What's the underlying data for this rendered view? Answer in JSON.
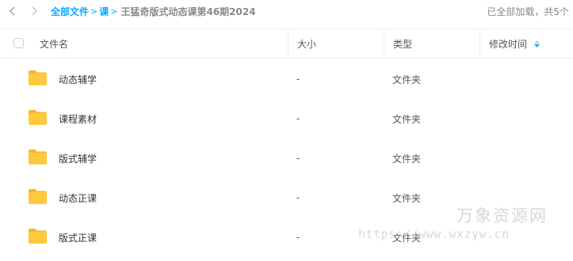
{
  "toolbar": {
    "back_icon": "chevron-left-icon",
    "forward_icon": "chevron-right-icon"
  },
  "breadcrumb": {
    "root": "全部文件",
    "separator": ">",
    "level1": "课",
    "current": "王猛奇版式动态课第46期2024"
  },
  "status": {
    "load_text": "已全部加载，共5个"
  },
  "table": {
    "columns": {
      "name": "文件名",
      "size": "大小",
      "type": "类型",
      "modified": "修改时间"
    },
    "rows": [
      {
        "name": "动态辅学",
        "size": "-",
        "type": "文件夹",
        "icon": "folder-icon"
      },
      {
        "name": "课程素材",
        "size": "-",
        "type": "文件夹",
        "icon": "folder-icon"
      },
      {
        "name": "版式辅学",
        "size": "-",
        "type": "文件夹",
        "icon": "folder-icon"
      },
      {
        "name": "动态正课",
        "size": "-",
        "type": "文件夹",
        "icon": "folder-icon"
      },
      {
        "name": "版式正课",
        "size": "-",
        "type": "文件夹",
        "icon": "folder-icon"
      }
    ]
  },
  "watermark": {
    "title": "万象资源网",
    "url": "https://www.wxzyw.cn"
  },
  "colors": {
    "accent": "#09aaff",
    "folder": "#ffc93c",
    "folder_tab": "#f5b82a"
  }
}
